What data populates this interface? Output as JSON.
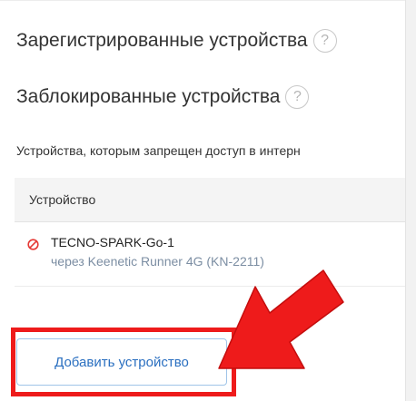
{
  "sections": {
    "registered_title": "Зарегистрированные устройства",
    "blocked_title": "Заблокированные устройства",
    "help_glyph": "?"
  },
  "blocked": {
    "description": "Устройства, которым запрещен доступ в интерн",
    "table": {
      "header": "Устройство",
      "rows": [
        {
          "name": "TECNO-SPARK-Go-1",
          "via": "через Keenetic Runner 4G (KN-2211)",
          "status_icon": "blocked-icon"
        }
      ]
    },
    "add_button_label": "Добавить устройство"
  },
  "annotation": {
    "highlight_color": "#ee1b1b",
    "arrow_color": "#ee1b1b"
  },
  "colors": {
    "link": "#2a6fc0",
    "muted": "#7c8ea3",
    "block_icon": "#e53935"
  }
}
